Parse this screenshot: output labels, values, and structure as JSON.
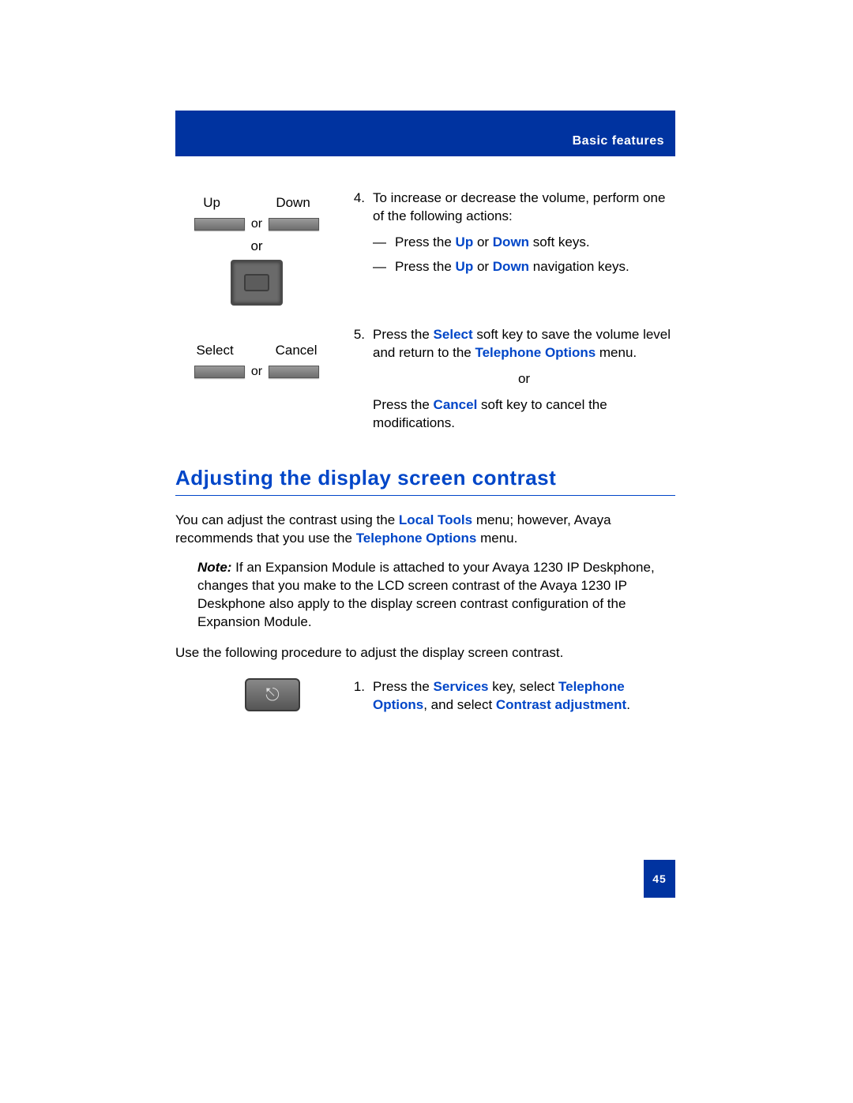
{
  "header": {
    "section": "Basic features"
  },
  "step4": {
    "labels": {
      "up": "Up",
      "down": "Down",
      "or1": "or",
      "or2": "or"
    },
    "num": "4.",
    "lead": "To increase or decrease the volume, perform one of the following actions:",
    "bullet1_a": "Press the ",
    "bullet1_b": "Up",
    "bullet1_c": " or ",
    "bullet1_d": "Down",
    "bullet1_e": " soft keys.",
    "bullet2_a": "Press the ",
    "bullet2_b": "Up",
    "bullet2_c": " or ",
    "bullet2_d": "Down",
    "bullet2_e": " navigation keys."
  },
  "step5": {
    "labels": {
      "select": "Select",
      "cancel": "Cancel",
      "or": "or"
    },
    "num": "5.",
    "p1_a": "Press the ",
    "p1_b": "Select",
    "p1_c": " soft key to save the volume level and return to the ",
    "p1_d": "Telephone Options",
    "p1_e": " menu.",
    "or": "or",
    "p2_a": "Press the ",
    "p2_b": "Cancel",
    "p2_c": " soft key to cancel the modifications."
  },
  "section": {
    "title": "Adjusting the display screen contrast",
    "intro_a": "You can adjust the contrast using the ",
    "intro_b": "Local Tools",
    "intro_c": " menu; however, Avaya recommends that you use the ",
    "intro_d": "Telephone Options",
    "intro_e": " menu.",
    "note_label": "Note:",
    "note_body": " If an Expansion Module is attached to your Avaya 1230 IP Deskphone, changes that you make to the LCD screen contrast of the Avaya 1230 IP Deskphone also apply to the display screen contrast configuration of the Expansion Module.",
    "proc_intro": "Use the following procedure to adjust the display screen contrast."
  },
  "proc_step1": {
    "num": "1.",
    "a": "Press the ",
    "b": "Services",
    "c": " key, select ",
    "d": "Telephone Options",
    "e": ", and select ",
    "f": "Contrast adjustment",
    "g": "."
  },
  "page_number": "45"
}
